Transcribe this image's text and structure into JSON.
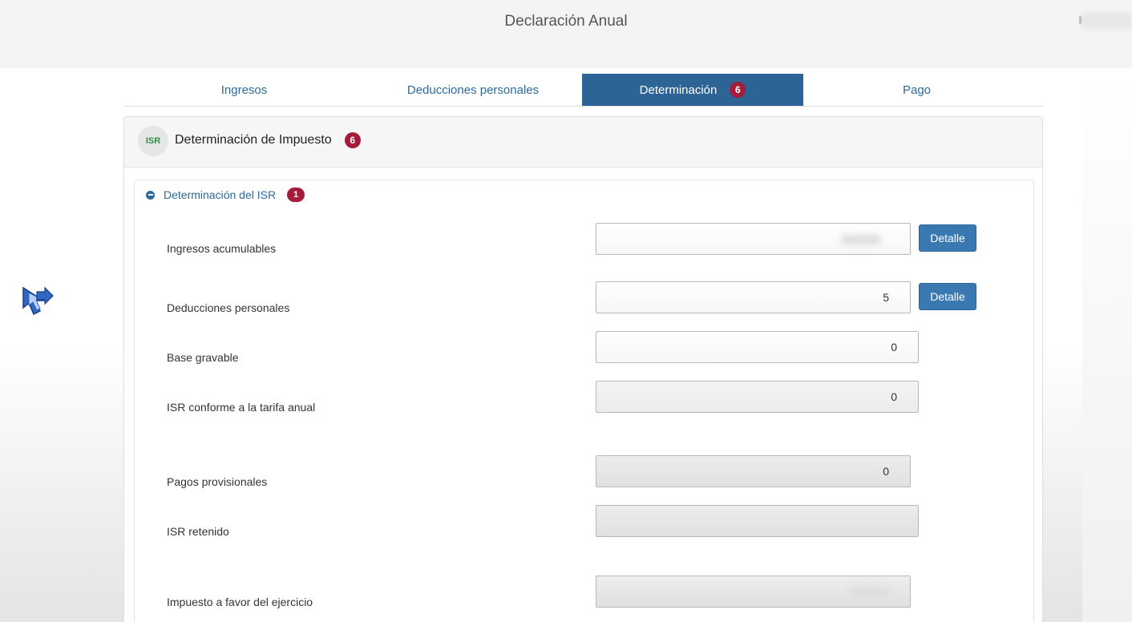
{
  "app": {
    "title": "Declaración Anual"
  },
  "colors": {
    "accent": "#2c6495",
    "badge": "#a51b3c",
    "isr_green": "#2e8b48"
  },
  "tabs": [
    {
      "label": "Ingresos",
      "active": false
    },
    {
      "label": "Deducciones personales",
      "active": false
    },
    {
      "label": "Determinación",
      "active": true,
      "badge": "6"
    },
    {
      "label": "Pago",
      "active": false
    }
  ],
  "panel": {
    "icon_text": "ISR",
    "title": "Determinación de Impuesto",
    "badge": "6"
  },
  "section": {
    "title": "Determinación del ISR",
    "badge": "1"
  },
  "fields": [
    {
      "label": "Ingresos acumulables",
      "value": "",
      "button": "Detalle"
    },
    {
      "label": "Deducciones personales",
      "value": "5",
      "button": "Detalle"
    },
    {
      "label": "Base gravable",
      "value": "0"
    },
    {
      "label": "ISR conforme a la tarifa anual",
      "value": "0"
    },
    {
      "label": "Pagos provisionales",
      "value": "0"
    },
    {
      "label": "ISR retenido",
      "value": ""
    },
    {
      "label": "Impuesto a favor del ejercicio",
      "value": ""
    }
  ],
  "side_icon": "cursor-arrow-icon"
}
